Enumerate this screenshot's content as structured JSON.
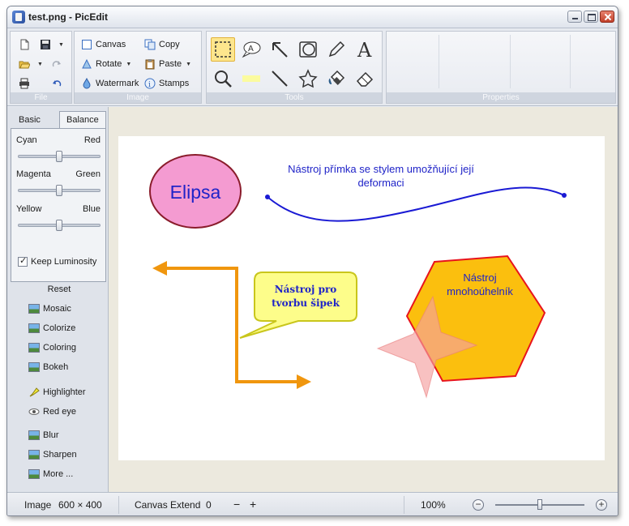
{
  "window": {
    "title": "test.png - PicEdit"
  },
  "ribbon": {
    "file": {
      "label": "File"
    },
    "image": {
      "label": "Image",
      "canvas": "Canvas",
      "copy": "Copy",
      "rotate": "Rotate",
      "paste": "Paste",
      "watermark": "Watermark",
      "stamps": "Stamps"
    },
    "tools": {
      "label": "Tools",
      "text_tool_glyph": "A"
    },
    "properties": {
      "label": "Properties"
    }
  },
  "left_panel": {
    "tabs": [
      {
        "label": "Basic"
      },
      {
        "label": "Balance"
      }
    ],
    "balance": [
      {
        "left": "Cyan",
        "right": "Red",
        "value": 0.5
      },
      {
        "left": "Magenta",
        "right": "Green",
        "value": 0.5
      },
      {
        "left": "Yellow",
        "right": "Blue",
        "value": 0.5
      }
    ],
    "keep_luminosity": {
      "label": "Keep Luminosity",
      "checked": true
    },
    "reset_label": "Reset",
    "effects": [
      {
        "label": "Mosaic",
        "icon": "mosaic-icon"
      },
      {
        "label": "Colorize",
        "icon": "colorize-icon"
      },
      {
        "label": "Coloring",
        "icon": "coloring-icon"
      },
      {
        "label": "Bokeh",
        "icon": "bokeh-icon"
      },
      {
        "label": "Highlighter",
        "icon": "highlighter-icon"
      },
      {
        "label": "Red eye",
        "icon": "red-eye-icon"
      },
      {
        "label": "Blur",
        "icon": "blur-icon"
      },
      {
        "label": "Sharpen",
        "icon": "sharpen-icon"
      },
      {
        "label": "More ...",
        "icon": "more-icon"
      }
    ]
  },
  "canvas": {
    "ellipse_text": "Elipsa",
    "line_text_1": "Nástroj přímka se stylem umožňující její",
    "line_text_2": "deformaci",
    "callout_text_1": "Nástroj pro",
    "callout_text_2": "tvorbu šipek",
    "polygon_text_1": "Nástroj",
    "polygon_text_2": "mnohoúhelník",
    "colors": {
      "ellipse_fill": "#f49bd1",
      "ellipse_stroke": "#8a1c2b",
      "line_stroke": "#1a1ad4",
      "arrow_stroke": "#f0960e",
      "callout_fill": "#fdfd8a",
      "callout_stroke": "#c9c61c",
      "polygon_fill": "#fbbf0e",
      "polygon_stroke": "#e8131c",
      "star_fill": "#f4a0a0",
      "text_blue": "#1f23c8"
    }
  },
  "status": {
    "image_label": "Image",
    "image_size": "600 × 400",
    "canvas_extend_label": "Canvas Extend",
    "canvas_extend_value": "0",
    "minus": "−",
    "plus": "+",
    "zoom": "100%",
    "zoom_level": 0.5
  }
}
